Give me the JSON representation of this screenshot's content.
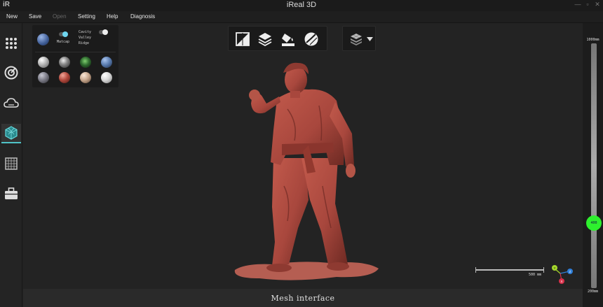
{
  "window": {
    "logo": "iR",
    "title": "iReal 3D",
    "controls": [
      "—",
      "▫",
      "✕"
    ]
  },
  "menu": [
    {
      "label": "New",
      "enabled": true
    },
    {
      "label": "Save",
      "enabled": true
    },
    {
      "label": "Open",
      "enabled": false
    },
    {
      "label": "Setting",
      "enabled": true
    },
    {
      "label": "Help",
      "enabled": true
    },
    {
      "label": "Diagnosis",
      "enabled": true
    }
  ],
  "sidebar": {
    "items": [
      {
        "name": "sidebar-item-grid",
        "icon": "dot-grid-icon"
      },
      {
        "name": "sidebar-item-scan",
        "icon": "target-icon"
      },
      {
        "name": "sidebar-item-cloud",
        "icon": "cloud-icon"
      },
      {
        "name": "sidebar-item-mesh",
        "icon": "mesh-icon",
        "active": true
      },
      {
        "name": "sidebar-item-texture",
        "icon": "grid-icon"
      },
      {
        "name": "sidebar-item-tools",
        "icon": "toolbox-icon"
      }
    ],
    "accent": "#4fc3c7"
  },
  "material_panel": {
    "matcap_label": "Matcap",
    "cavity_options": "Cavity\nValley\nRidge",
    "matcap_colors": [
      "#c8c8c8",
      "#9a9a9a",
      "#2f6b2f",
      "#5577aa",
      "#7d7d88",
      "#b34a3e",
      "#c7a78e",
      "#d8d8d8"
    ]
  },
  "toolbar": {
    "tools": [
      "split-view-icon",
      "layers-icon",
      "paint-bucket-icon",
      "texture-ball-icon"
    ],
    "dropdown_icon": "layer-stack-icon"
  },
  "model": {
    "color": "#a8473d"
  },
  "scale": {
    "label": "500 mm"
  },
  "axes": {
    "y": {
      "label": "Y",
      "color": "#a6d92c"
    },
    "z": {
      "label": "Z",
      "color": "#2f7fd9"
    },
    "x": {
      "label": "X",
      "color": "#d9304a"
    }
  },
  "depth": {
    "max_label": "1000mm",
    "min_label": "200mm",
    "current_label": "400",
    "knob_color": "#2ef02e"
  },
  "status": {
    "text": "Mesh interface"
  }
}
